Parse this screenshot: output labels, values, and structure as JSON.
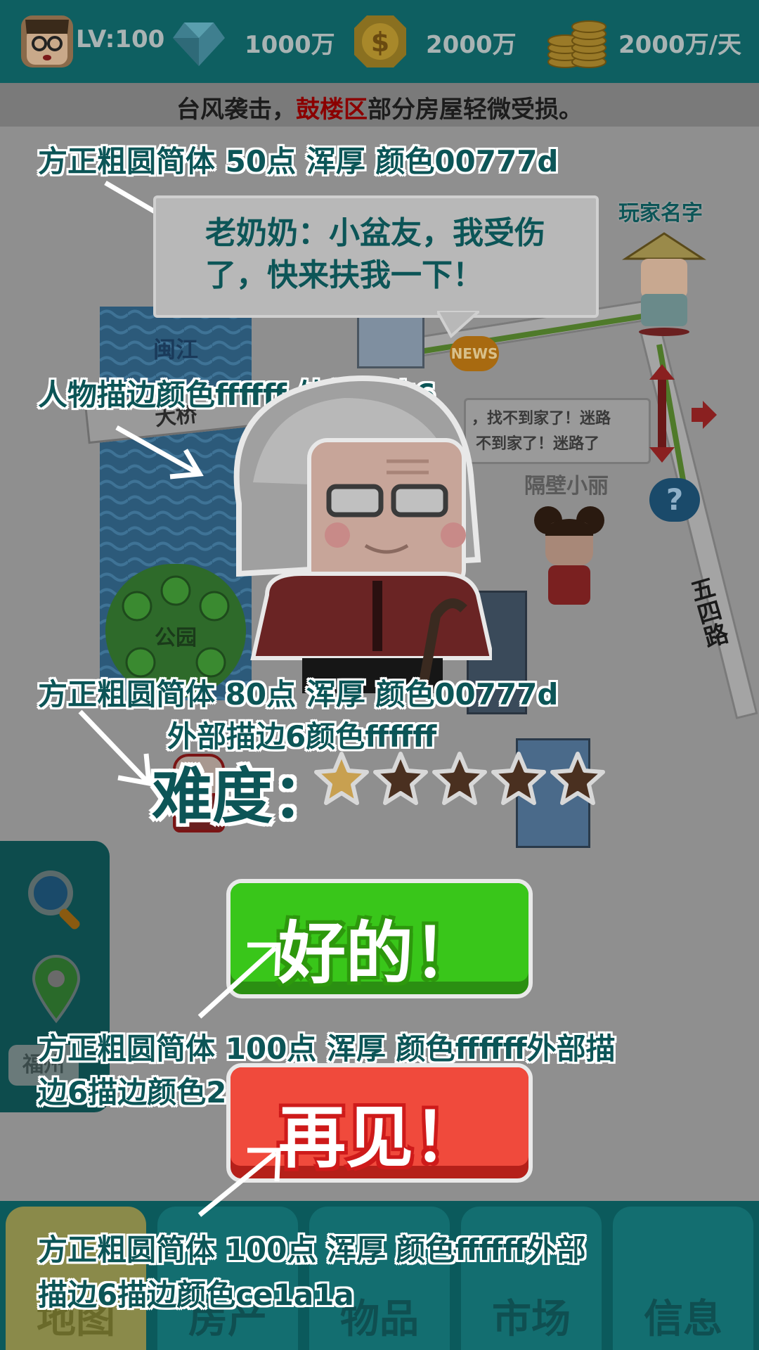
{
  "status_bar": {
    "level": "LV:100",
    "diamonds": "1000万",
    "coins": "2000万",
    "income": "2000万/天"
  },
  "ticker": {
    "prefix": "台风袭击，",
    "highlight": "鼓楼区",
    "suffix": "部分房屋轻微受损。"
  },
  "map_labels": {
    "river": "闽江",
    "bridge": "大桥",
    "park": "公园",
    "road": "五四路",
    "news": "NEWS",
    "player_name": "玩家名字",
    "neighbor_name": "隔壁小丽",
    "lost_text_1": "，找不到家了！迷路",
    "lost_text_2": "不到家了！迷路了",
    "city_tab": "福州"
  },
  "annotations": {
    "bubble_font": "方正粗圆简体   50点    浑厚    颜色00777d",
    "character_stroke": "人物描边颜色ffffff  外部描边6",
    "difficulty_font_1": "方正粗圆简体   80点    浑厚    颜色00777d",
    "difficulty_font_2": "外部描边6颜色ffffff",
    "ok_font_1": "方正粗圆简体 100点    浑厚    颜色ffffff外部描",
    "ok_font_2": "边6描边颜色2d980d",
    "bye_font_1": "方正粗圆简体  100点    浑厚    颜色ffffff外部",
    "bye_font_2": "描边6描边颜色ce1a1a"
  },
  "dialog": {
    "speech": "老奶奶：小盆友，我受伤了，快来扶我一下！",
    "difficulty_label": "难度：",
    "difficulty_stars": 1,
    "difficulty_max": 5,
    "ok_button": "好的！",
    "bye_button": "再见！"
  },
  "bottom_nav": {
    "tabs": [
      "地图",
      "房产",
      "物品",
      "市场",
      "信息"
    ]
  },
  "colors": {
    "title_teal": "#00777d",
    "stroke_white": "#ffffff",
    "ok_stroke": "#2d980d",
    "bye_stroke": "#ce1a1a"
  }
}
